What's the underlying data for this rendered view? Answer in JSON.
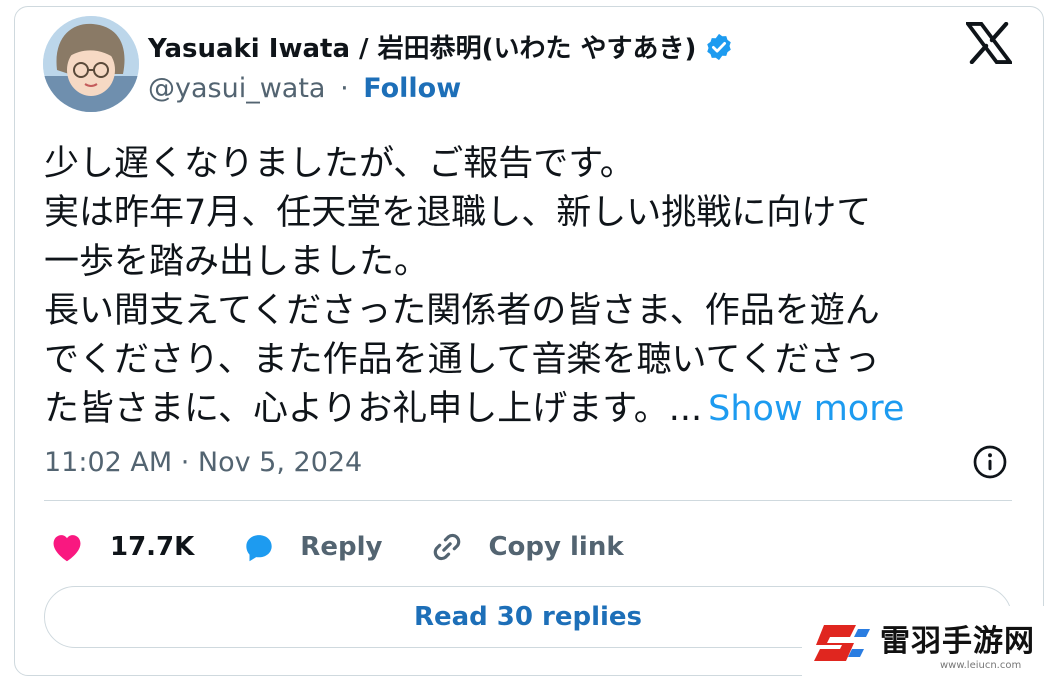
{
  "author": {
    "display_name": "Yasuaki Iwata / 岩田恭明(いわた やすあき)",
    "handle": "@yasui_wata",
    "separator": "·",
    "follow_label": "Follow",
    "verified_icon": "verified-badge-icon"
  },
  "brand_icon": "x-logo-icon",
  "post": {
    "lines": [
      "少し遅くなりましたが、ご報告です。",
      "実は昨年7月、任天堂を退職し、新しい挑戦に向けて",
      "一歩を踏み出しました。",
      "長い間支えてくださった関係者の皆さま、作品を遊ん",
      "でくださり、また作品を通して音楽を聴いてくださっ",
      "た皆さまに、心よりお礼申し上げます。..."
    ],
    "show_more_label": "Show more",
    "timestamp": "11:02 AM · Nov 5, 2024"
  },
  "actions": {
    "like_count": "17.7K",
    "reply_label": "Reply",
    "copy_link_label": "Copy link"
  },
  "read_replies_label": "Read 30 replies",
  "watermark": {
    "title": "雷羽手游网",
    "url": "www.leiucn.com"
  },
  "colors": {
    "accent": "#1d9bf0",
    "follow": "#1d6fb8",
    "like": "#f91880",
    "text": "#0f1419",
    "muted": "#536471",
    "border": "#cfd9de"
  }
}
